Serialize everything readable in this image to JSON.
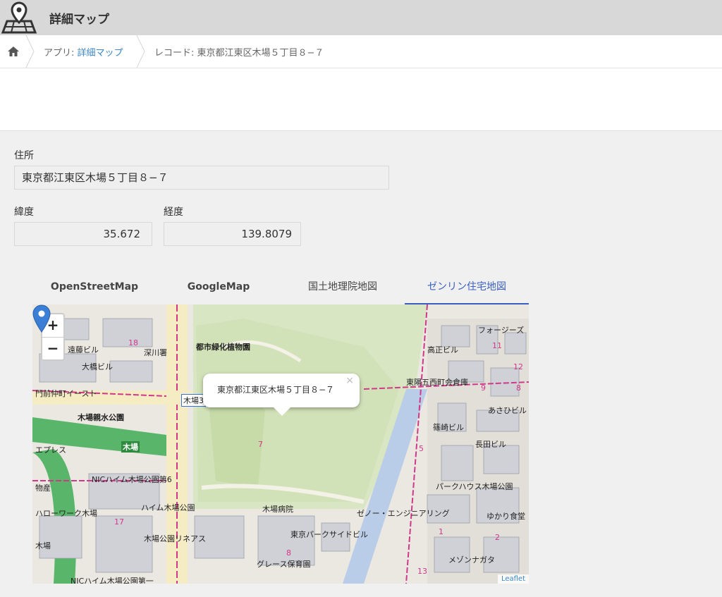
{
  "header": {
    "title": "詳細マップ",
    "icon": "map-pin-icon"
  },
  "breadcrumb": {
    "home_icon": "home-icon",
    "app_prefix": "アプリ: ",
    "app_link": "詳細マップ",
    "record": "レコード: 東京都江東区木場５丁目８−７"
  },
  "form": {
    "address_label": "住所",
    "address_value": "東京都江東区木場５丁目８−７",
    "lat_label": "緯度",
    "lat_value": "35.672",
    "lng_label": "経度",
    "lng_value": "139.8079"
  },
  "tabs": [
    {
      "label": "OpenStreetMap",
      "active": false
    },
    {
      "label": "GoogleMap",
      "active": false
    },
    {
      "label": "国土地理院地図",
      "active": false
    },
    {
      "label": "ゼンリン住宅地図",
      "active": true
    }
  ],
  "map": {
    "zoom_in": "+",
    "zoom_out": "−",
    "popup_text": "東京都江東区木場５丁目８−７",
    "popup_close": "×",
    "attribution": "Leaflet",
    "labels": {
      "ryokka": "都市緑化植物園",
      "fukagawa": "深川署",
      "ohashi": "大橋ビル",
      "enomoto": "遠藤ビル",
      "kiba3": "木場3",
      "kiba_station": "木場",
      "shinsui": "木場親水公園",
      "nic1": "NICハイム木場公園第6",
      "heim": "ハイム木場公園",
      "hospital": "木場病院",
      "parkside": "東京パークサイドビル",
      "grace": "グレース保育園",
      "nic2": "NICハイム木場公園第一",
      "takamasa": "高正ビル",
      "higashiyo": "東陽五西町会倉庫",
      "asahi": "あさひビル",
      "shinozaki": "篠崎ビル",
      "nagata": "長田ビル",
      "parkhouse": "パークハウス木場公園",
      "engineering": "ゼノー・エンジニアリング",
      "yukari": "ゆかり食堂",
      "hellowork": "ハローワーク木場",
      "rineas": "木場公園リネアス",
      "mesonagata": "メゾンナガタ",
      "forges": "フォージーズ",
      "nakacho": "門前仲町イースト",
      "kiba_top": "木場",
      "express": "エプレス",
      "butsuryu": "物産",
      "kiba_left": "木場"
    },
    "numbers": {
      "n18": "18",
      "n7": "7",
      "n11": "11",
      "n12": "12",
      "n9": "9",
      "n8": "8",
      "n5": "5",
      "n17": "17",
      "n8b": "8",
      "n13": "13",
      "n2": "2",
      "n1": "1"
    }
  }
}
